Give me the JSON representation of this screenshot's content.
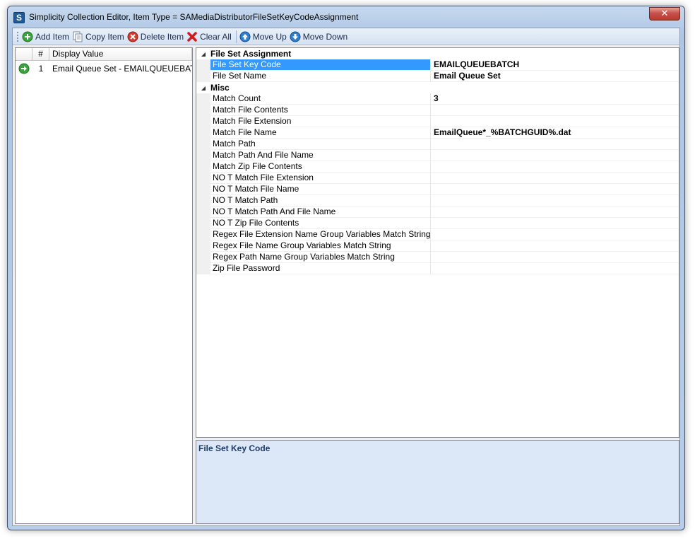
{
  "window": {
    "title": "Simplicity Collection Editor, Item Type = SAMediaDistributorFileSetKeyCodeAssignment",
    "app_icon_letter": "S",
    "close_glyph": "✕"
  },
  "toolbar": {
    "add_label": "Add Item",
    "copy_label": "Copy Item",
    "delete_label": "Delete Item",
    "clear_label": "Clear All",
    "move_up_label": "Move Up",
    "move_down_label": "Move Down"
  },
  "list": {
    "headers": {
      "num": "#",
      "display": "Display Value"
    },
    "rows": [
      {
        "num": "1",
        "display": "Email Queue Set - EMAILQUEUEBAT..."
      }
    ]
  },
  "properties": {
    "categories": [
      {
        "name": "File Set Assignment",
        "rows": [
          {
            "name": "File Set Key Code",
            "value": "EMAILQUEUEBATCH"
          },
          {
            "name": "File Set Name",
            "value": "Email Queue Set"
          }
        ]
      },
      {
        "name": "Misc",
        "rows": [
          {
            "name": "Match Count",
            "value": "3"
          },
          {
            "name": "Match File Contents",
            "value": ""
          },
          {
            "name": "Match File Extension",
            "value": ""
          },
          {
            "name": "Match File Name",
            "value": "EmailQueue*_%BATCHGUID%.dat"
          },
          {
            "name": "Match Path",
            "value": ""
          },
          {
            "name": "Match Path And File Name",
            "value": ""
          },
          {
            "name": "Match Zip File Contents",
            "value": ""
          },
          {
            "name": "NO T Match File Extension",
            "value": ""
          },
          {
            "name": "NO T Match File Name",
            "value": ""
          },
          {
            "name": "NO T Match Path",
            "value": ""
          },
          {
            "name": "NO T Match Path And File Name",
            "value": ""
          },
          {
            "name": "NO T Zip File Contents",
            "value": ""
          },
          {
            "name": "Regex File Extension Name Group Variables Match String",
            "value": ""
          },
          {
            "name": "Regex File Name Group Variables Match String",
            "value": ""
          },
          {
            "name": "Regex Path Name Group Variables Match String",
            "value": ""
          },
          {
            "name": "Zip File Password",
            "value": ""
          }
        ]
      }
    ]
  },
  "description": {
    "title": "File Set Key Code"
  },
  "colors": {
    "selection": "#3399ff",
    "desc_bg": "#dce8f8",
    "add_green": "#3aa53a",
    "delete_red": "#d63a2a",
    "move_blue": "#2f7fd0"
  }
}
